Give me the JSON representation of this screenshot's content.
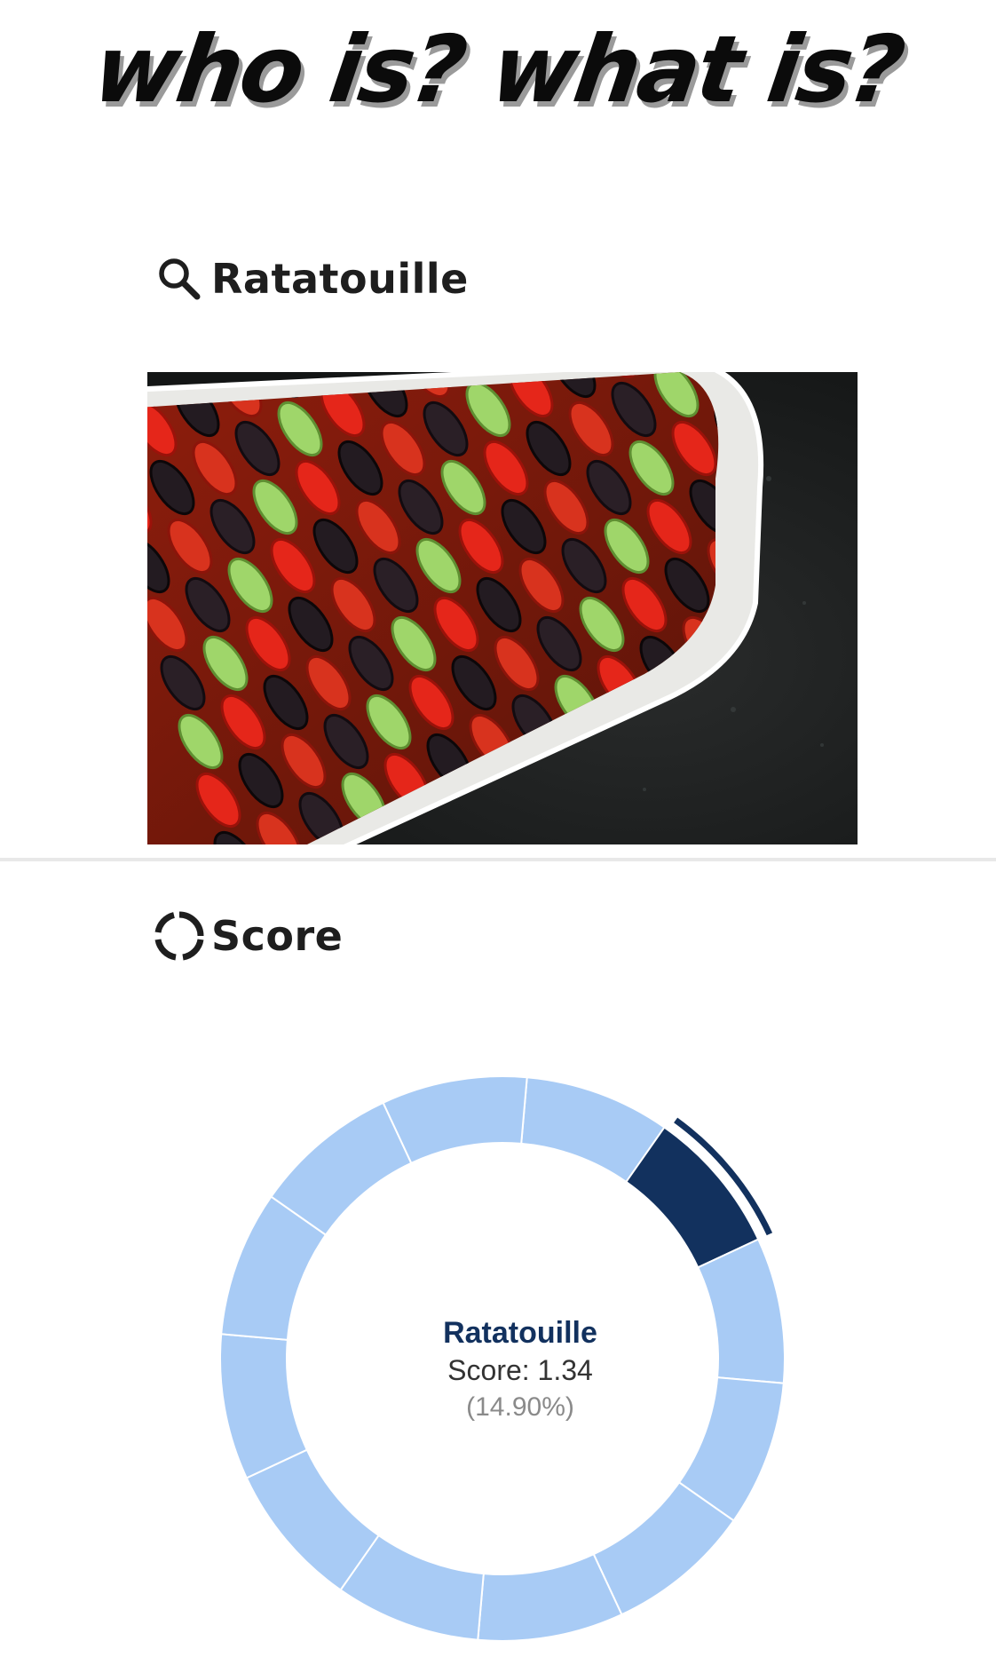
{
  "app": {
    "title": "who is? what is?"
  },
  "search": {
    "query": "Ratatouille",
    "icon": "magnifier-icon"
  },
  "image": {
    "subject": "Ratatouille"
  },
  "score_section": {
    "title": "Score",
    "icon": "circular-progress-icon"
  },
  "chart_data": {
    "type": "pie",
    "variant": "donut",
    "segment_count": 12,
    "selected_index": 1,
    "selected": {
      "label": "Ratatouille",
      "score_text": "Score: 1.34",
      "percent_text": "(14.90%)",
      "score": 1.34,
      "percent": 14.9
    },
    "colors": {
      "selected": "#12315e",
      "other": "#a8cbf5",
      "separator": "#ffffff"
    }
  }
}
